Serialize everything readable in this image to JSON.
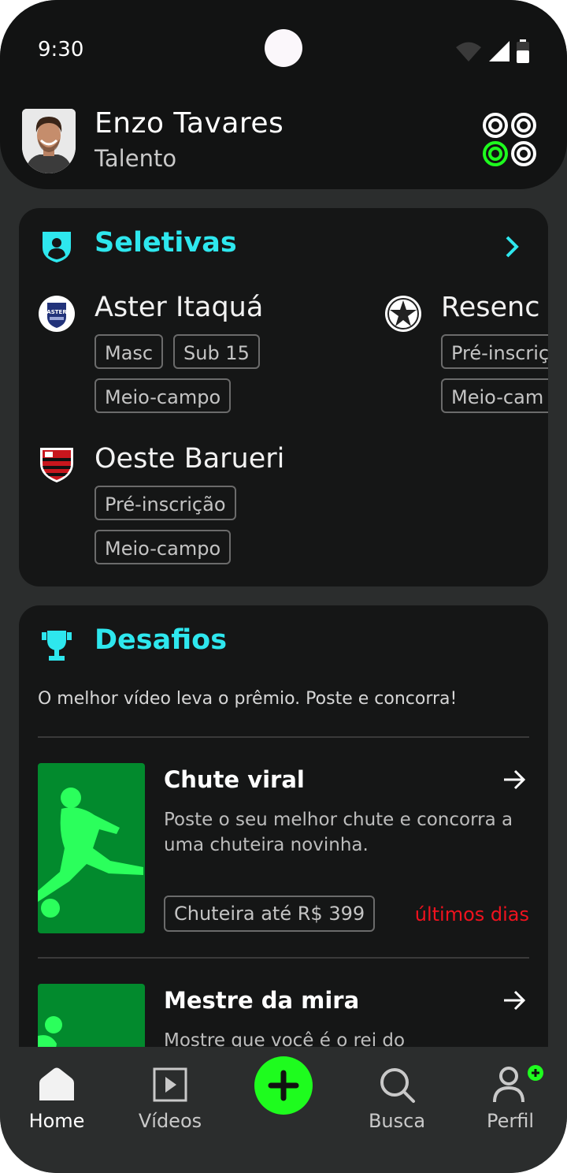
{
  "status_bar": {
    "time": "9:30"
  },
  "header": {
    "user_name": "Enzo Tavares",
    "user_role": "Talento",
    "colors": {
      "accent_green": "#1efc1e",
      "background": "#121313"
    }
  },
  "seletivas": {
    "title": "Seletivas",
    "icon": "shield-user-icon",
    "clubs": [
      {
        "name": "Aster Itaquá",
        "tags": [
          "Masc",
          "Sub 15",
          "Meio-campo"
        ]
      },
      {
        "name": "Resenc",
        "tags": [
          "Pré-inscriç",
          "Meio-cam"
        ]
      },
      {
        "name": "Oeste Barueri",
        "tags": [
          "Pré-inscrição",
          "Meio-campo"
        ]
      }
    ]
  },
  "desafios": {
    "title": "Desafios",
    "icon": "trophy-icon",
    "subtitle": "O melhor vídeo leva o prêmio. Poste e concorra!",
    "challenges": [
      {
        "title": "Chute viral",
        "description": "Poste o seu melhor chute e concorra a uma chuteira novinha.",
        "prize": "Chuteira até R$ 399",
        "deadline": "últimos dias"
      },
      {
        "title": "Mestre da mira",
        "description": "Mostre que você é o rei do"
      }
    ]
  },
  "nav": {
    "home": "Home",
    "videos": "Vídeos",
    "search": "Busca",
    "profile": "Perfil"
  },
  "theme": {
    "title_cyan": "#2ee7ee",
    "deadline_red": "#f0121e",
    "thumb_green": "#028a2d"
  }
}
